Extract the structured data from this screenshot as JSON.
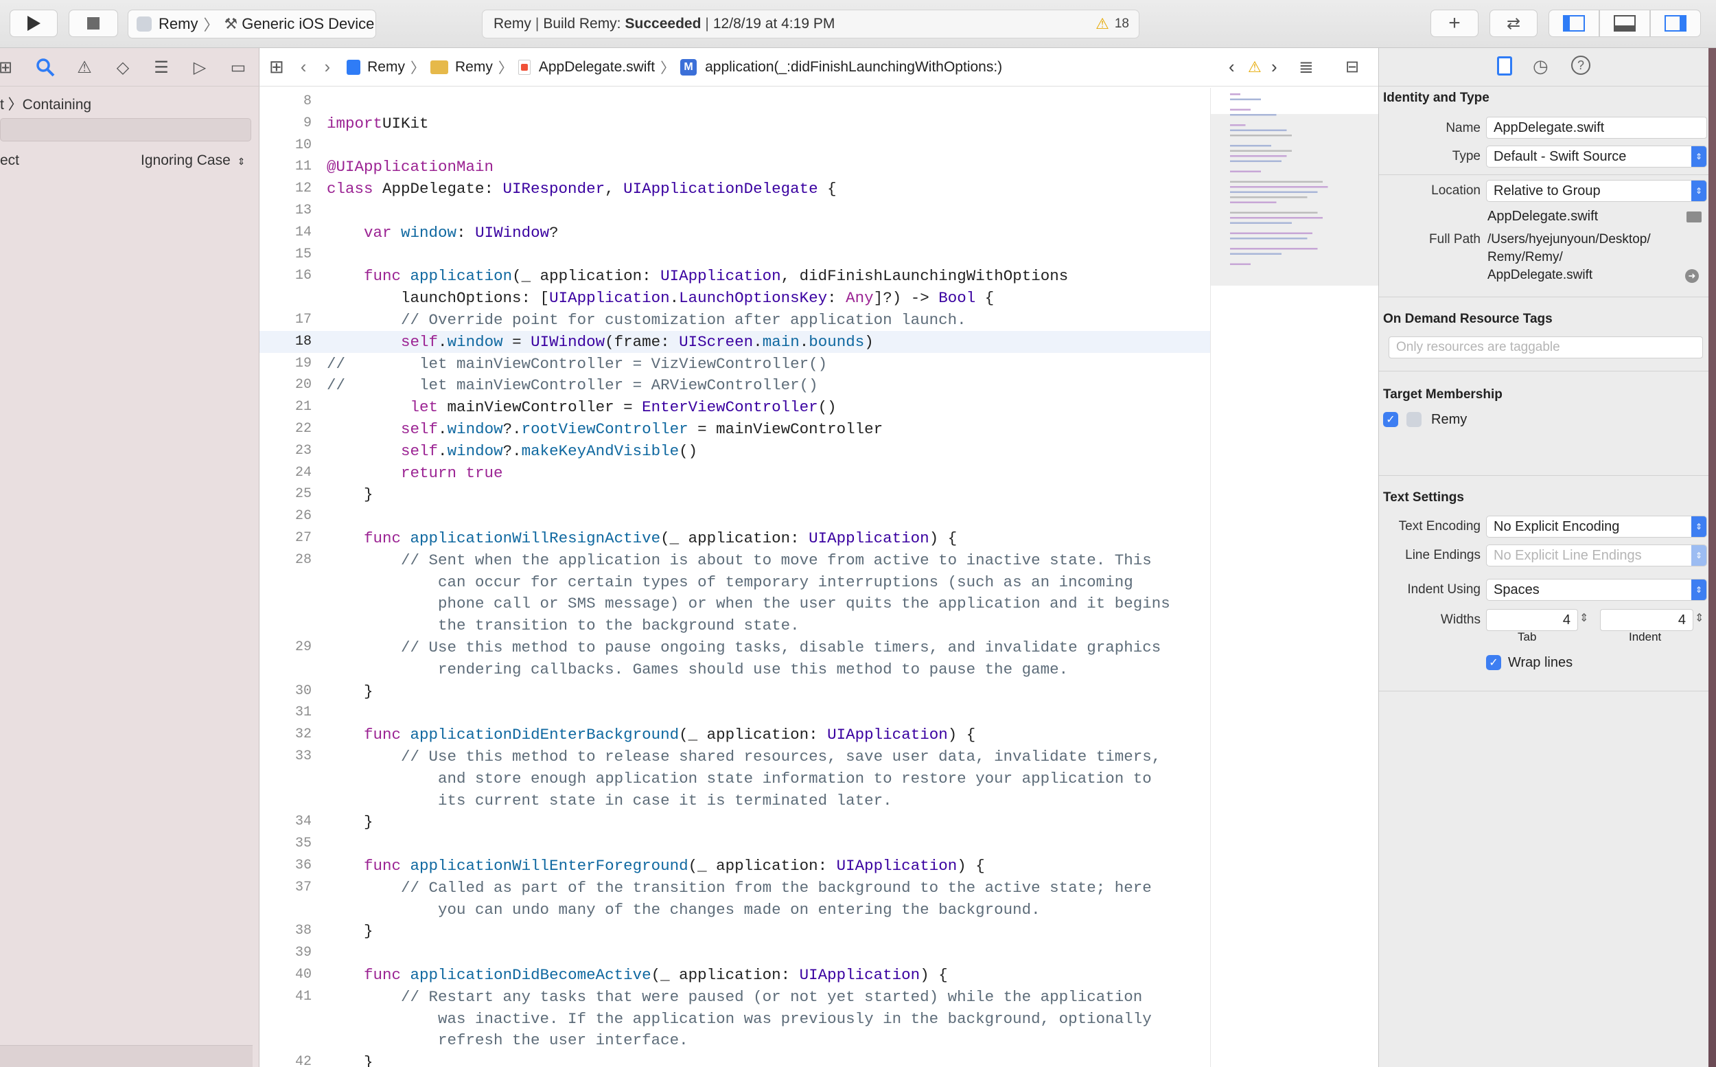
{
  "toolbar": {
    "scheme_target": "Remy",
    "scheme_device": "Generic iOS Device",
    "activity_project": "Remy",
    "activity_action": "Build Remy:",
    "activity_status": "Succeeded",
    "activity_time": "12/8/19 at 4:19 PM",
    "warning_count": "18"
  },
  "navigator": {
    "crumb": "t 〉Containing",
    "match_left": "ect",
    "match_mode": "Ignoring Case"
  },
  "jumpbar": {
    "items": [
      "Remy",
      "Remy",
      "AppDelegate.swift",
      "application(_:didFinishLaunchingWithOptions:)"
    ]
  },
  "editor": {
    "current_line": "18",
    "lines": [
      {
        "n": "8",
        "parts": []
      },
      {
        "n": "9",
        "parts": [
          [
            "kw",
            "import"
          ],
          [
            "",
            "UIKit"
          ]
        ]
      },
      {
        "n": "10",
        "parts": []
      },
      {
        "n": "11",
        "parts": [
          [
            "kw",
            "@UIApplicationMain"
          ]
        ]
      },
      {
        "n": "12",
        "parts": [
          [
            "kw",
            "class"
          ],
          [
            "",
            " AppDelegate: "
          ],
          [
            "ty",
            "UIResponder"
          ],
          [
            "",
            ", "
          ],
          [
            "ty",
            "UIApplicationDelegate"
          ],
          [
            "",
            " {"
          ]
        ]
      },
      {
        "n": "13",
        "parts": []
      },
      {
        "n": "14",
        "parts": [
          [
            "",
            "    "
          ],
          [
            "kw",
            "var"
          ],
          [
            "",
            " "
          ],
          [
            "fn",
            "window"
          ],
          [
            "",
            ": "
          ],
          [
            "ty",
            "UIWindow"
          ],
          [
            "",
            "?"
          ]
        ]
      },
      {
        "n": "15",
        "parts": []
      },
      {
        "n": "16",
        "parts": [
          [
            "",
            "    "
          ],
          [
            "kw",
            "func"
          ],
          [
            "",
            " "
          ],
          [
            "fn",
            "application"
          ],
          [
            "",
            "(_ application: "
          ],
          [
            "ty",
            "UIApplication"
          ],
          [
            "",
            ", didFinishLaunchingWithOptions"
          ]
        ]
      },
      {
        "n": "",
        "parts": [
          [
            "",
            "        launchOptions: ["
          ],
          [
            "ty",
            "UIApplication"
          ],
          [
            "",
            "."
          ],
          [
            "ty",
            "LaunchOptionsKey"
          ],
          [
            "",
            ": "
          ],
          [
            "kw",
            "Any"
          ],
          [
            "",
            "]?) -> "
          ],
          [
            "ty",
            "Bool"
          ],
          [
            "",
            " {"
          ]
        ]
      },
      {
        "n": "17",
        "parts": [
          [
            "",
            "        "
          ],
          [
            "cm",
            "// Override point for customization after application launch."
          ]
        ]
      },
      {
        "n": "18",
        "parts": [
          [
            "",
            "        "
          ],
          [
            "kw",
            "self"
          ],
          [
            "",
            "."
          ],
          [
            "fn",
            "window"
          ],
          [
            "",
            " = "
          ],
          [
            "ty",
            "UIWindow"
          ],
          [
            "",
            "(frame: "
          ],
          [
            "ty",
            "UIScreen"
          ],
          [
            "",
            "."
          ],
          [
            "fn",
            "main"
          ],
          [
            "",
            "."
          ],
          [
            "fn",
            "bounds"
          ],
          [
            "",
            ")"
          ]
        ]
      },
      {
        "n": "19",
        "parts": [
          [
            "cm",
            "//        let mainViewController = VizViewController()"
          ]
        ]
      },
      {
        "n": "20",
        "parts": [
          [
            "cm",
            "//        let mainViewController = ARViewController()"
          ]
        ]
      },
      {
        "n": "21",
        "parts": [
          [
            "",
            "         "
          ],
          [
            "kw",
            "let"
          ],
          [
            "",
            " mainViewController = "
          ],
          [
            "ty",
            "EnterViewController"
          ],
          [
            "",
            "()"
          ]
        ]
      },
      {
        "n": "22",
        "parts": [
          [
            "",
            "        "
          ],
          [
            "kw",
            "self"
          ],
          [
            "",
            "."
          ],
          [
            "fn",
            "window"
          ],
          [
            "",
            "?."
          ],
          [
            "fn",
            "rootViewController"
          ],
          [
            "",
            " = mainViewController"
          ]
        ]
      },
      {
        "n": "23",
        "parts": [
          [
            "",
            "        "
          ],
          [
            "kw",
            "self"
          ],
          [
            "",
            "."
          ],
          [
            "fn",
            "window"
          ],
          [
            "",
            "?."
          ],
          [
            "fn",
            "makeKeyAndVisible"
          ],
          [
            "",
            "()"
          ]
        ]
      },
      {
        "n": "24",
        "parts": [
          [
            "",
            "        "
          ],
          [
            "kw",
            "return true"
          ]
        ]
      },
      {
        "n": "25",
        "parts": [
          [
            "",
            "    }"
          ]
        ]
      },
      {
        "n": "26",
        "parts": []
      },
      {
        "n": "27",
        "parts": [
          [
            "",
            "    "
          ],
          [
            "kw",
            "func"
          ],
          [
            "",
            " "
          ],
          [
            "fn",
            "applicationWillResignActive"
          ],
          [
            "",
            "(_ application: "
          ],
          [
            "ty",
            "UIApplication"
          ],
          [
            "",
            ") {"
          ]
        ]
      },
      {
        "n": "28",
        "parts": [
          [
            "",
            "        "
          ],
          [
            "cm",
            "// Sent when the application is about to move from active to inactive state. This"
          ]
        ]
      },
      {
        "n": "",
        "parts": [
          [
            "",
            "            "
          ],
          [
            "cm",
            "can occur for certain types of temporary interruptions (such as an incoming"
          ]
        ]
      },
      {
        "n": "",
        "parts": [
          [
            "",
            "            "
          ],
          [
            "cm",
            "phone call or SMS message) or when the user quits the application and it begins"
          ]
        ]
      },
      {
        "n": "",
        "parts": [
          [
            "",
            "            "
          ],
          [
            "cm",
            "the transition to the background state."
          ]
        ]
      },
      {
        "n": "29",
        "parts": [
          [
            "",
            "        "
          ],
          [
            "cm",
            "// Use this method to pause ongoing tasks, disable timers, and invalidate graphics"
          ]
        ]
      },
      {
        "n": "",
        "parts": [
          [
            "",
            "            "
          ],
          [
            "cm",
            "rendering callbacks. Games should use this method to pause the game."
          ]
        ]
      },
      {
        "n": "30",
        "parts": [
          [
            "",
            "    }"
          ]
        ]
      },
      {
        "n": "31",
        "parts": []
      },
      {
        "n": "32",
        "parts": [
          [
            "",
            "    "
          ],
          [
            "kw",
            "func"
          ],
          [
            "",
            " "
          ],
          [
            "fn",
            "applicationDidEnterBackground"
          ],
          [
            "",
            "(_ application: "
          ],
          [
            "ty",
            "UIApplication"
          ],
          [
            "",
            ") {"
          ]
        ]
      },
      {
        "n": "33",
        "parts": [
          [
            "",
            "        "
          ],
          [
            "cm",
            "// Use this method to release shared resources, save user data, invalidate timers,"
          ]
        ]
      },
      {
        "n": "",
        "parts": [
          [
            "",
            "            "
          ],
          [
            "cm",
            "and store enough application state information to restore your application to"
          ]
        ]
      },
      {
        "n": "",
        "parts": [
          [
            "",
            "            "
          ],
          [
            "cm",
            "its current state in case it is terminated later."
          ]
        ]
      },
      {
        "n": "34",
        "parts": [
          [
            "",
            "    }"
          ]
        ]
      },
      {
        "n": "35",
        "parts": []
      },
      {
        "n": "36",
        "parts": [
          [
            "",
            "    "
          ],
          [
            "kw",
            "func"
          ],
          [
            "",
            " "
          ],
          [
            "fn",
            "applicationWillEnterForeground"
          ],
          [
            "",
            "(_ application: "
          ],
          [
            "ty",
            "UIApplication"
          ],
          [
            "",
            ") {"
          ]
        ]
      },
      {
        "n": "37",
        "parts": [
          [
            "",
            "        "
          ],
          [
            "cm",
            "// Called as part of the transition from the background to the active state; here"
          ]
        ]
      },
      {
        "n": "",
        "parts": [
          [
            "",
            "            "
          ],
          [
            "cm",
            "you can undo many of the changes made on entering the background."
          ]
        ]
      },
      {
        "n": "38",
        "parts": [
          [
            "",
            "    }"
          ]
        ]
      },
      {
        "n": "39",
        "parts": []
      },
      {
        "n": "40",
        "parts": [
          [
            "",
            "    "
          ],
          [
            "kw",
            "func"
          ],
          [
            "",
            " "
          ],
          [
            "fn",
            "applicationDidBecomeActive"
          ],
          [
            "",
            "(_ application: "
          ],
          [
            "ty",
            "UIApplication"
          ],
          [
            "",
            ") {"
          ]
        ]
      },
      {
        "n": "41",
        "parts": [
          [
            "",
            "        "
          ],
          [
            "cm",
            "// Restart any tasks that were paused (or not yet started) while the application"
          ]
        ]
      },
      {
        "n": "",
        "parts": [
          [
            "",
            "            "
          ],
          [
            "cm",
            "was inactive. If the application was previously in the background, optionally"
          ]
        ]
      },
      {
        "n": "",
        "parts": [
          [
            "",
            "            "
          ],
          [
            "cm",
            "refresh the user interface."
          ]
        ]
      },
      {
        "n": "42",
        "parts": [
          [
            "",
            "    }"
          ]
        ]
      }
    ]
  },
  "inspector": {
    "identity_title": "Identity and Type",
    "name_label": "Name",
    "name_value": "AppDelegate.swift",
    "type_label": "Type",
    "type_value": "Default - Swift Source",
    "location_label": "Location",
    "location_value": "Relative to Group",
    "location_file": "AppDelegate.swift",
    "fullpath_label": "Full Path",
    "fullpath_1": "/Users/hyejunyoun/Desktop/",
    "fullpath_2": "Remy/Remy/",
    "fullpath_3": "AppDelegate.swift",
    "odr_title": "On Demand Resource Tags",
    "odr_placeholder": "Only resources are taggable",
    "target_title": "Target Membership",
    "target_name": "Remy",
    "text_title": "Text Settings",
    "encoding_label": "Text Encoding",
    "encoding_value": "No Explicit Encoding",
    "endings_label": "Line Endings",
    "endings_value": "No Explicit Line Endings",
    "indent_label": "Indent Using",
    "indent_value": "Spaces",
    "widths_label": "Widths",
    "tab_value": "4",
    "indent_width_value": "4",
    "tab_caption": "Tab",
    "indent_caption": "Indent",
    "wrap_label": "Wrap lines"
  }
}
